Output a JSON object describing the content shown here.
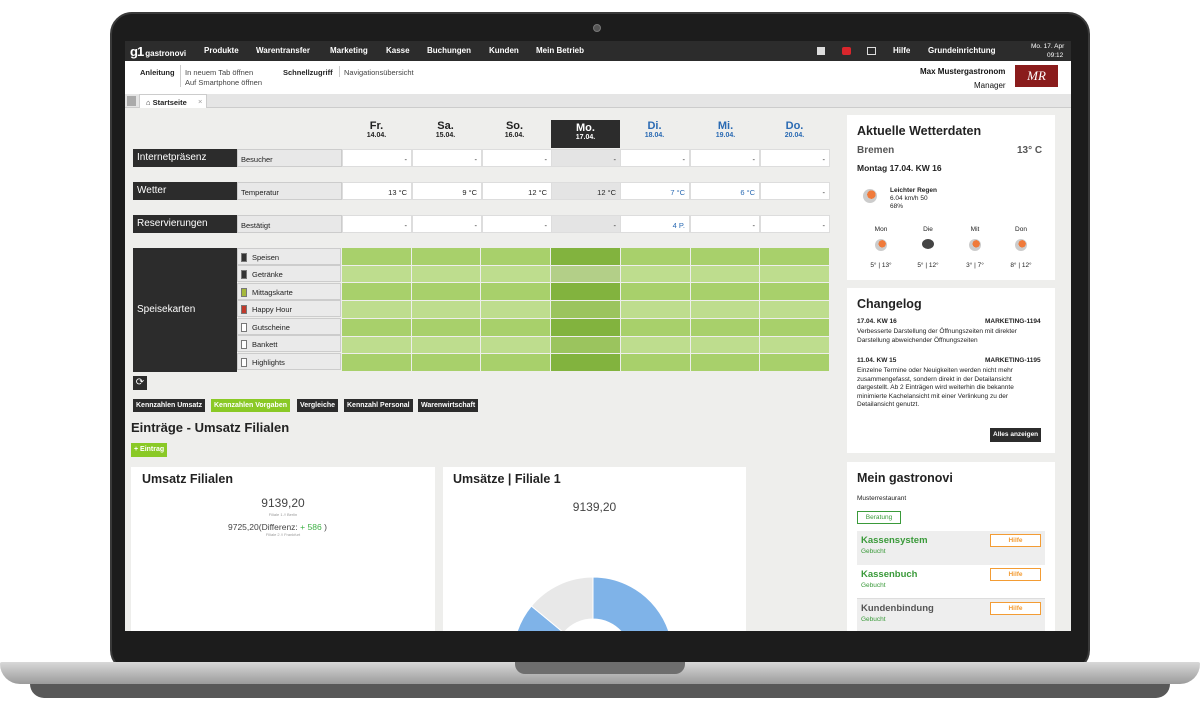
{
  "topnav": {
    "logo": "gastronovi",
    "items": [
      "Produkte",
      "Warentransfer",
      "Marketing",
      "Kasse",
      "Buchungen",
      "Kunden",
      "Mein Betrieb"
    ],
    "right_items": [
      "Hilfe",
      "Grundeinrichtung"
    ],
    "date": "Mo. 17. Apr",
    "time": "09:12"
  },
  "subbar": {
    "anleitung": "Anleitung",
    "open_tab": "In neuem Tab öffnen",
    "smartphone": "Auf Smartphone öffnen",
    "schnellzugriff": "Schnellzugriff",
    "nav_overview": "Navigationsübersicht",
    "user_name": "Max Mustergastronom",
    "user_role": "Manager",
    "user_logo": "MR"
  },
  "tabs": {
    "home": "Startseite",
    "close": "×"
  },
  "days": [
    {
      "name": "Fr.",
      "date": "14.04."
    },
    {
      "name": "Sa.",
      "date": "15.04."
    },
    {
      "name": "So.",
      "date": "16.04."
    },
    {
      "name": "Mo.",
      "date": "17.04."
    },
    {
      "name": "Di.",
      "date": "18.04."
    },
    {
      "name": "Mi.",
      "date": "19.04."
    },
    {
      "name": "Do.",
      "date": "20.04."
    }
  ],
  "rows": {
    "internet": {
      "label": "Internetpräsenz",
      "sub": "Besucher",
      "values": [
        "-",
        "-",
        "-",
        "-",
        "-",
        "-",
        "-"
      ]
    },
    "wetter": {
      "label": "Wetter",
      "sub": "Temperatur",
      "values": [
        "13 °C",
        "9 °C",
        "12 °C",
        "12 °C",
        "7 °C",
        "6 °C",
        "-"
      ]
    },
    "reserv": {
      "label": "Reservierungen",
      "sub": "Bestätigt",
      "values": [
        "-",
        "-",
        "-",
        "-",
        "4 P.",
        "-",
        "-"
      ]
    }
  },
  "speisekarten": {
    "label": "Speisekarten",
    "items": [
      "Speisen",
      "Getränke",
      "Mittagskarte",
      "Happy Hour",
      "Gutscheine",
      "Bankett",
      "Highlights"
    ]
  },
  "buttons": [
    "Kennzahlen Umsatz",
    "Kennzahlen Vorgaben",
    "Vergleiche",
    "Kennzahl Personal",
    "Warenwirtschaft"
  ],
  "entries": {
    "title": "Einträge - Umsatz Filialen",
    "add": "+ Eintrag"
  },
  "umsatz": {
    "title": "Umsatz Filialen",
    "value1": "9139,20",
    "branch1": "Filiale 1 // Berlin",
    "value2": "9725,20",
    "diff_label": "(Differenz:",
    "diff_value": "+ 586",
    "diff_close": ")",
    "branch2": "Filiale 2 // Frankfurt"
  },
  "umsatz2": {
    "title": "Umsätze | Filiale 1",
    "value": "9139,20"
  },
  "weather": {
    "title": "Aktuelle Wetterdaten",
    "city": "Bremen",
    "temp": "13° C",
    "date": "Montag 17.04.  KW 16",
    "condition": "Leichter Regen",
    "wind": "6.04 km/h 50",
    "humidity": "68%",
    "forecast": [
      {
        "day": "Mon",
        "range": "5° | 13°"
      },
      {
        "day": "Die",
        "range": "5° | 12°"
      },
      {
        "day": "Mit",
        "range": "3° | 7°"
      },
      {
        "day": "Don",
        "range": "8° | 12°"
      }
    ]
  },
  "changelog": {
    "title": "Changelog",
    "entries": [
      {
        "date": "17.04.  KW 16",
        "tag": "MARKETING-1194",
        "text": "Verbesserte Darstellung der Öffnungszeiten mit direkter Darstellung abweichender Öffnungszeiten"
      },
      {
        "date": "11.04.  KW 15",
        "tag": "MARKETING-1195",
        "text": "Einzelne Termine oder Neuigkeiten werden nicht mehr zusammengefasst, sondern direkt in der Detailansicht dargestellt. Ab 2 Einträgen wird weiterhin die bekannte minimierte Kachelansicht mit einer Verlinkung zu der Detailansicht genutzt."
      }
    ],
    "all_button": "Alles anzeigen"
  },
  "mein": {
    "title": "Mein gastronovi",
    "restaurant": "Musterrestaurant",
    "beratung": "Beratung",
    "products": [
      {
        "name": "Kassensystem",
        "status": "Gebucht",
        "help": "Hilfe"
      },
      {
        "name": "Kassenbuch",
        "status": "Gebucht",
        "help": "Hilfe"
      },
      {
        "name": "Kundenbindung",
        "status": "Gebucht",
        "help": "Hilfe"
      }
    ]
  },
  "chart_data": {
    "type": "pie",
    "title": "Umsätze | Filiale 1",
    "center_value": "9139,20",
    "slices": [
      {
        "value": 0.86,
        "color": "#7fb3e8"
      },
      {
        "value": 0.14,
        "color": "#e8e8e8"
      }
    ]
  }
}
